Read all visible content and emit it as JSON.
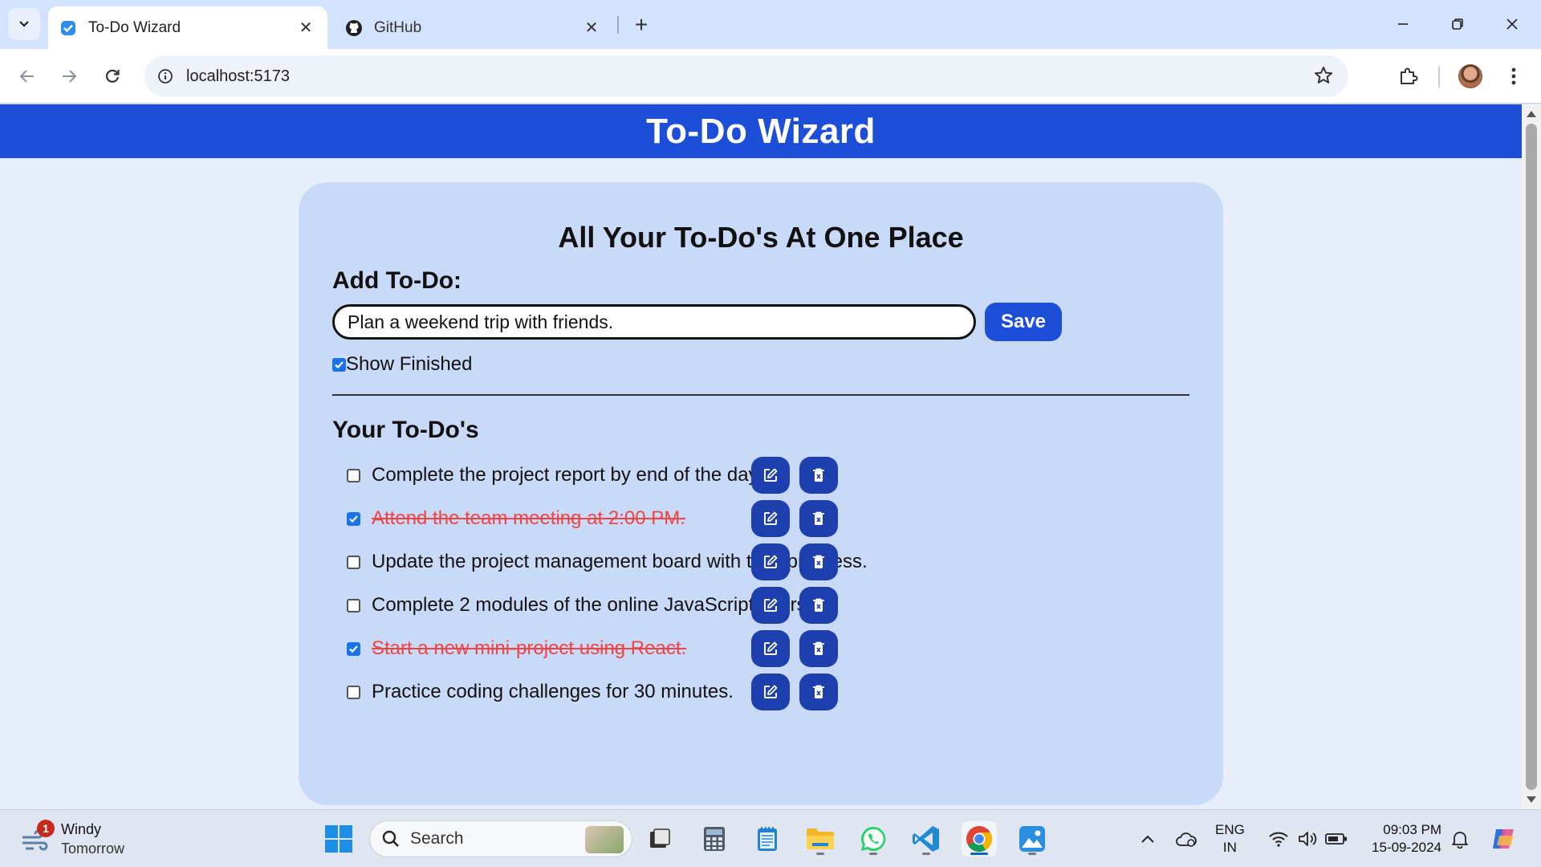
{
  "browser": {
    "tabs": [
      {
        "title": "To-Do Wizard",
        "active": true
      },
      {
        "title": "GitHub",
        "active": false
      }
    ],
    "url": "localhost:5173"
  },
  "app": {
    "title": "To-Do Wizard",
    "heading": "All Your To-Do's At One Place",
    "add_label": "Add To-Do:",
    "input_value": "Plan a weekend trip with friends.",
    "save_label": "Save",
    "show_finished_label": "Show Finished",
    "show_finished_checked": true,
    "list_title": "Your To-Do's",
    "todos": [
      {
        "text": "Complete the project report by end of the day.",
        "done": false
      },
      {
        "text": "Attend the team meeting at 2:00 PM.",
        "done": true
      },
      {
        "text": "Update the project management board with task progress.",
        "done": false
      },
      {
        "text": "Complete 2 modules of the online JavaScript course.",
        "done": false
      },
      {
        "text": "Start a new mini-project using React.",
        "done": true
      },
      {
        "text": "Practice coding challenges for 30 minutes.",
        "done": false
      }
    ],
    "colors": {
      "header": "#1d4ed8",
      "card": "#c9daf8",
      "icon_button": "#1e3fae",
      "done_text": "#ef4444"
    }
  },
  "taskbar": {
    "weather_title": "Windy",
    "weather_sub": "Tomorrow",
    "weather_badge": "1",
    "search_label": "Search",
    "lang_line1": "ENG",
    "lang_line2": "IN",
    "time": "09:03 PM",
    "date": "15-09-2024"
  }
}
